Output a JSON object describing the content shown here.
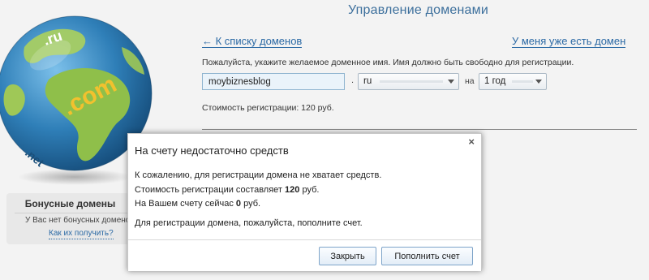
{
  "header": {
    "title": "Управление доменами"
  },
  "nav": {
    "back_link": "← К списку доменов",
    "have_domain_link": "У меня уже есть домен"
  },
  "form": {
    "hint": "Пожалуйста, укажите желаемое доменное имя. Имя должно быть свободно для регистрации.",
    "domain_value": "moybiznesblog",
    "dot": ".",
    "tld_selected": "ru",
    "period_label": "на",
    "period_selected": "1 год",
    "cost_line": "Стоимость регистрации: 120 руб."
  },
  "globe": {
    "labels": [
      ".ru",
      ".com",
      ".net"
    ],
    "colors": {
      "ocean": "#2f7fb8",
      "land": "#8fbf4a",
      "text": "#f2c12e"
    }
  },
  "bonus": {
    "title": "Бонусные домены",
    "none_text": "У Вас нет бонусных доменов",
    "how_link": "Как их получить?"
  },
  "modal": {
    "title": "На счету недостаточно средств",
    "close_icon": "×",
    "line1": "К сожалению, для регистрации домена не хватает средств.",
    "line2_prefix": "Стоимость регистрации составляет ",
    "line2_amount": "120",
    "line2_suffix": " руб.",
    "line3_prefix": "На Вашем счету сейчас ",
    "line3_amount": "0",
    "line3_suffix": " руб.",
    "line4": "Для регистрации домена, пожалуйста, пополните счет.",
    "close_button": "Закрыть",
    "topup_button": "Пополнить счет"
  }
}
